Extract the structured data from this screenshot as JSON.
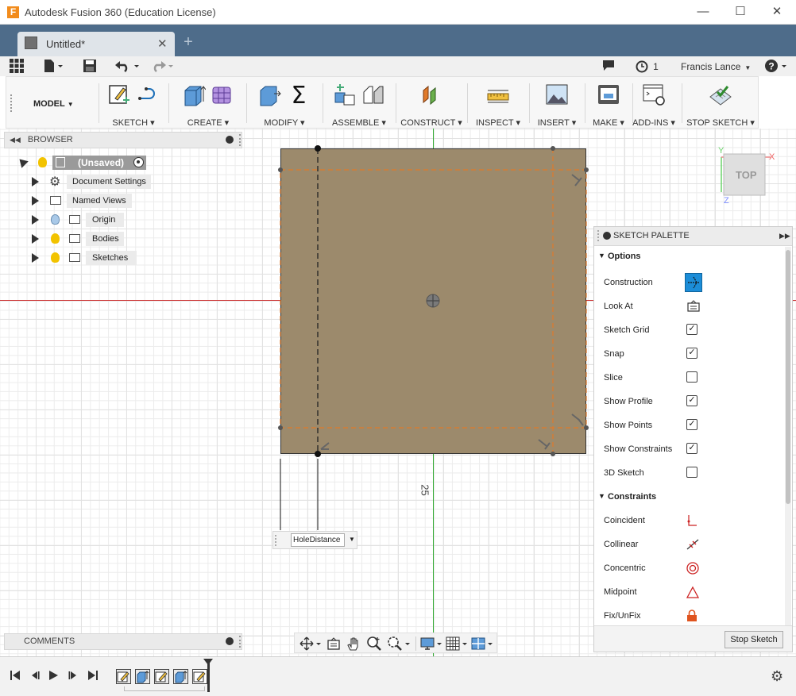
{
  "window": {
    "title": "Autodesk Fusion 360 (Education License)",
    "logo": "F"
  },
  "document_tab": {
    "name": "Untitled*"
  },
  "quick_access": {
    "history_count": "1",
    "user": "Francis Lance"
  },
  "toolbar": {
    "workspace": "MODEL",
    "groups": [
      {
        "label": "SKETCH"
      },
      {
        "label": "CREATE"
      },
      {
        "label": "MODIFY"
      },
      {
        "label": "ASSEMBLE"
      },
      {
        "label": "CONSTRUCT"
      },
      {
        "label": "INSPECT"
      },
      {
        "label": "INSERT"
      },
      {
        "label": "MAKE"
      },
      {
        "label": "ADD-INS"
      },
      {
        "label": "STOP SKETCH"
      }
    ]
  },
  "browser": {
    "title": "BROWSER",
    "root": "(Unsaved)",
    "items": [
      {
        "label": "Document Settings"
      },
      {
        "label": "Named Views"
      },
      {
        "label": "Origin"
      },
      {
        "label": "Bodies"
      },
      {
        "label": "Sketches"
      }
    ]
  },
  "comments": {
    "title": "COMMENTS"
  },
  "viewcube": {
    "face": "TOP",
    "x_axis": "X",
    "y_axis": "Y",
    "z_axis": "Z"
  },
  "canvas": {
    "dimension_value": "25",
    "input_value": "HoleDistance"
  },
  "palette": {
    "title": "SKETCH PALETTE",
    "options_header": "Options",
    "options": [
      {
        "label": "Construction",
        "type": "button"
      },
      {
        "label": "Look At",
        "type": "icon"
      },
      {
        "label": "Sketch Grid",
        "checked": true
      },
      {
        "label": "Snap",
        "checked": true
      },
      {
        "label": "Slice",
        "checked": false
      },
      {
        "label": "Show Profile",
        "checked": true
      },
      {
        "label": "Show Points",
        "checked": true
      },
      {
        "label": "Show Constraints",
        "checked": true
      },
      {
        "label": "3D Sketch",
        "checked": false
      }
    ],
    "constraints_header": "Constraints",
    "constraints": [
      {
        "label": "Coincident"
      },
      {
        "label": "Collinear"
      },
      {
        "label": "Concentric"
      },
      {
        "label": "Midpoint"
      },
      {
        "label": "Fix/UnFix"
      }
    ],
    "stop_button": "Stop Sketch"
  },
  "colors": {
    "titlebar_tab": "#4e6c8a",
    "sketch_fill": "#9c8a6c",
    "construction_line": "#e07a2a",
    "axis_red": "#cc3333",
    "axis_green": "#33aa33",
    "highlight_blue": "#1c8dd8"
  }
}
